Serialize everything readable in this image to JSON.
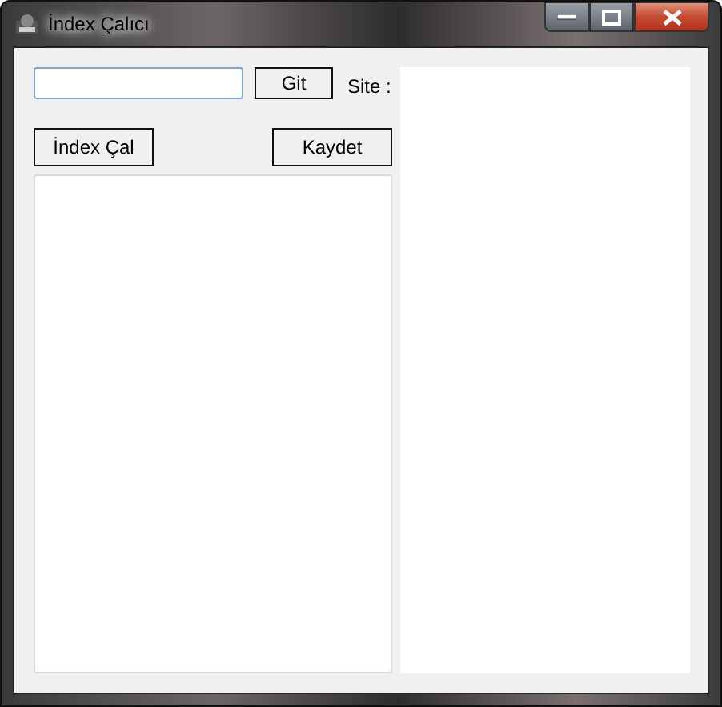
{
  "window": {
    "title": "İndex Çalıcı"
  },
  "go_button": {
    "label": "Git"
  },
  "site_label": "Site :",
  "steal_button": {
    "label": "İndex Çal"
  },
  "save_button": {
    "label": "Kaydet"
  }
}
